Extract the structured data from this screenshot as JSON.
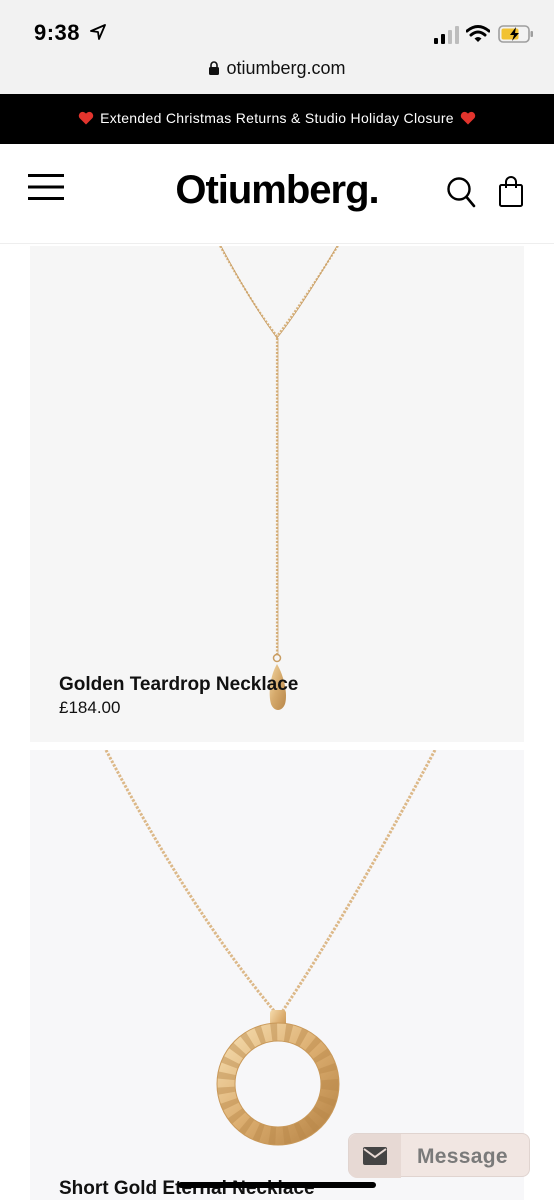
{
  "status_bar": {
    "time": "9:38"
  },
  "browser": {
    "url": "otiumberg.com"
  },
  "announcement": {
    "text": "Extended Christmas Returns & Studio Holiday Closure"
  },
  "header": {
    "logo": "Otiumberg."
  },
  "products": [
    {
      "name": "Golden Teardrop Necklace",
      "price": "£184.00"
    },
    {
      "name": "Short Gold Eternal Necklace"
    }
  ],
  "chat_widget": {
    "label": "Message"
  },
  "colors": {
    "announcement_bg": "#000000",
    "heart": "#e2342d",
    "gold": "#d9b178",
    "card_bg": "#f6f6f6",
    "message_bg": "#f1e6e2"
  }
}
